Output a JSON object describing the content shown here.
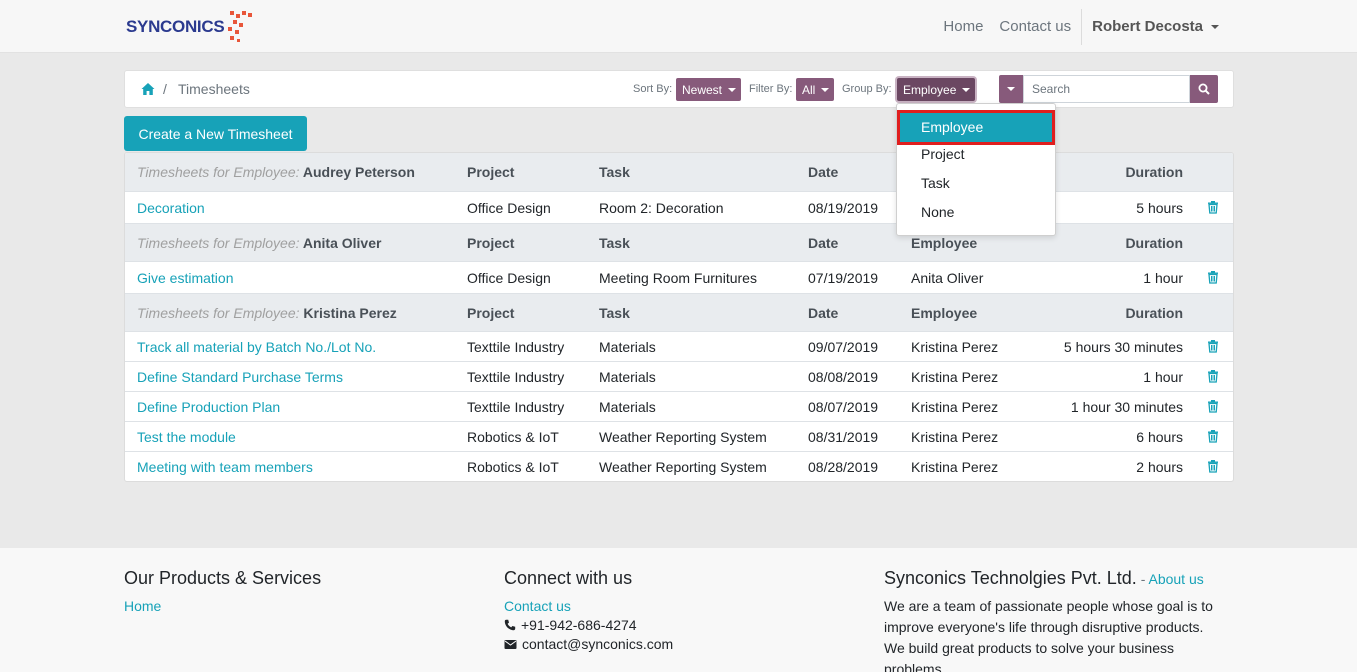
{
  "navbar": {
    "logo_text": "SYNCONICS",
    "links": [
      "Home",
      "Contact us"
    ],
    "user": "Robert Decosta"
  },
  "breadcrumb": {
    "current": "Timesheets"
  },
  "controls": {
    "sort_label": "Sort By:",
    "sort_value": "Newest",
    "filter_label": "Filter By:",
    "filter_value": "All",
    "group_label": "Group By:",
    "group_value": "Employee",
    "search_placeholder": "Search"
  },
  "create_button": "Create a New Timesheet",
  "group_by_menu": {
    "items": [
      "Employee",
      "Project",
      "Task",
      "None"
    ],
    "selected": "Employee"
  },
  "table": {
    "group_prefix": "Timesheets for Employee:",
    "headers": {
      "project": "Project",
      "task": "Task",
      "date": "Date",
      "employee": "Employee",
      "duration": "Duration"
    },
    "groups": [
      {
        "employee": "Audrey Peterson",
        "rows": [
          {
            "name": "Decoration",
            "project": "Office Design",
            "task": "Room 2: Decoration",
            "date": "08/19/2019",
            "employee": "",
            "duration": "5 hours"
          }
        ]
      },
      {
        "employee": "Anita Oliver",
        "rows": [
          {
            "name": "Give estimation",
            "project": "Office Design",
            "task": "Meeting Room Furnitures",
            "date": "07/19/2019",
            "employee": "Anita Oliver",
            "duration": "1 hour"
          }
        ]
      },
      {
        "employee": "Kristina Perez",
        "rows": [
          {
            "name": "Track all material by Batch No./Lot No.",
            "project": "Texttile Industry",
            "task": "Materials",
            "date": "09/07/2019",
            "employee": "Kristina Perez",
            "duration": "5 hours 30 minutes"
          },
          {
            "name": "Define Standard Purchase Terms",
            "project": "Texttile Industry",
            "task": "Materials",
            "date": "08/08/2019",
            "employee": "Kristina Perez",
            "duration": "1 hour"
          },
          {
            "name": "Define Production Plan",
            "project": "Texttile Industry",
            "task": "Materials",
            "date": "08/07/2019",
            "employee": "Kristina Perez",
            "duration": "1 hour 30 minutes"
          },
          {
            "name": "Test the module",
            "project": "Robotics & IoT",
            "task": "Weather Reporting System",
            "date": "08/31/2019",
            "employee": "Kristina Perez",
            "duration": "6 hours"
          },
          {
            "name": "Meeting with team members",
            "project": "Robotics & IoT",
            "task": "Weather Reporting System",
            "date": "08/28/2019",
            "employee": "Kristina Perez",
            "duration": "2 hours"
          }
        ]
      }
    ]
  },
  "footer": {
    "products": {
      "title": "Our Products & Services",
      "links": [
        "Home"
      ]
    },
    "connect": {
      "title": "Connect with us",
      "link": "Contact us",
      "phone": "+91-942-686-4274",
      "email": "contact@synconics.com"
    },
    "company": {
      "title": "Synconics Technolgies Pvt. Ltd.",
      "sep": " - ",
      "about_link": "About us",
      "description": "We are a team of passionate people whose goal is to improve everyone's life through disruptive products. We build great products to solve your business problems."
    }
  },
  "colors": {
    "accent": "#875a7b",
    "link": "#17a2b8",
    "highlight": "#e01e1e"
  }
}
